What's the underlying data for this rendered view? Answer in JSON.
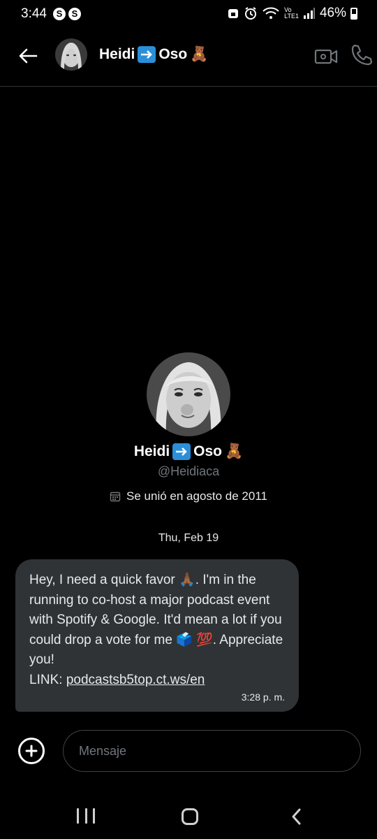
{
  "status_bar": {
    "time": "3:44",
    "battery": "46%",
    "battery_level": 0.46
  },
  "header": {
    "title_first": "Heidi",
    "title_second": "Oso",
    "title_emoji": "🧸"
  },
  "profile": {
    "name_first": "Heidi",
    "name_second": "Oso",
    "name_emoji": "🧸",
    "handle": "@Heidiaca",
    "joined": "Se unió en agosto de 2011"
  },
  "conversation": {
    "date": "Thu, Feb 19",
    "message": {
      "part1": "Hey, I need a quick favor ",
      "emoji_pray": "🙏🏾",
      "part2": ". I'm in the running to co-host a major podcast event with Spotify & Google. It'd mean a lot if you could drop a vote for me ",
      "emoji_ballot": "🗳️",
      "emoji_100": "💯",
      "part3": ". Appreciate you!",
      "link_label": "LINK: ",
      "link_text": "podcastsb5top.ct.ws/en",
      "time": "3:28 p. m."
    }
  },
  "composer": {
    "placeholder": "Mensaje"
  },
  "colors": {
    "background": "#000000",
    "bubble": "#2f3336",
    "muted": "#71767b",
    "arrow_box": "#2a8fd8"
  },
  "icons": [
    "back-arrow-icon",
    "video-call-icon",
    "phone-icon",
    "calendar-icon",
    "plus-circle-icon",
    "recents-icon",
    "home-icon",
    "nav-back-icon"
  ]
}
